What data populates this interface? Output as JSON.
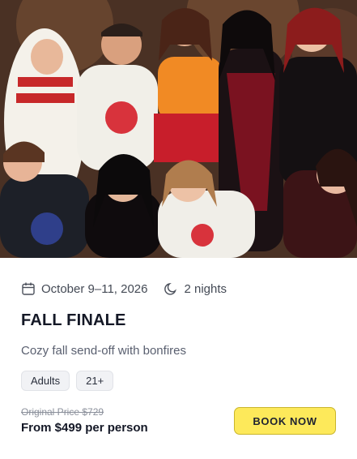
{
  "event": {
    "image_alt": "Group of people in Halloween costumes",
    "dates": "October 9–11, 2026",
    "duration": "2 nights",
    "title": "FALL FINALE",
    "description": "Cozy fall send-off with bonfires",
    "tags": [
      "Adults",
      "21+"
    ],
    "original_price": "Original Price $729",
    "price": "From $499 per person",
    "book_label": "BOOK NOW"
  },
  "icons": {
    "dates": "calendar-icon",
    "duration": "moon-icon"
  },
  "colors": {
    "button_bg": "#fde95a",
    "title": "#141826",
    "muted_text": "#5a6070"
  }
}
